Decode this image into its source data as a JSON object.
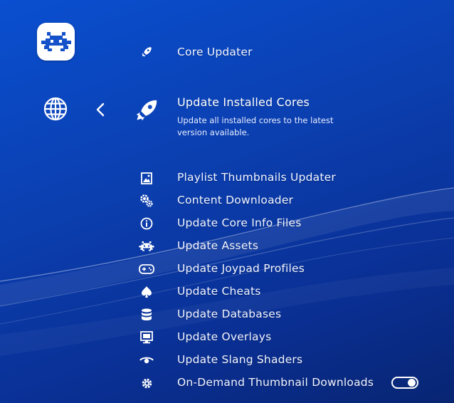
{
  "header": {
    "title": "Core Updater",
    "title_icon": "rocket-icon"
  },
  "sidebar": {
    "logo_icon": "retroarch-invader-icon",
    "tab_icon": "globe-icon",
    "back_icon": "chevron-left-icon"
  },
  "selected": {
    "label": "Update Installed Cores",
    "sublabel": "Update all installed cores to the latest version available.",
    "icon": "rocket-icon"
  },
  "menu": [
    {
      "label": "Playlist Thumbnails Updater",
      "icon": "image-icon"
    },
    {
      "label": "Content Downloader",
      "icon": "gears-icon"
    },
    {
      "label": "Update Core Info Files",
      "icon": "info-icon"
    },
    {
      "label": "Update Assets",
      "icon": "invader-icon"
    },
    {
      "label": "Update Joypad Profiles",
      "icon": "gamepad-icon"
    },
    {
      "label": "Update Cheats",
      "icon": "spade-icon"
    },
    {
      "label": "Update Databases",
      "icon": "database-icon"
    },
    {
      "label": "Update Overlays",
      "icon": "monitor-icon"
    },
    {
      "label": "Update Slang Shaders",
      "icon": "eye-icon"
    },
    {
      "label": "On-Demand Thumbnail Downloads",
      "icon": "gear-icon",
      "toggle": "on"
    }
  ],
  "colors": {
    "background": "#0b3fb0",
    "text": "#ffffff"
  }
}
